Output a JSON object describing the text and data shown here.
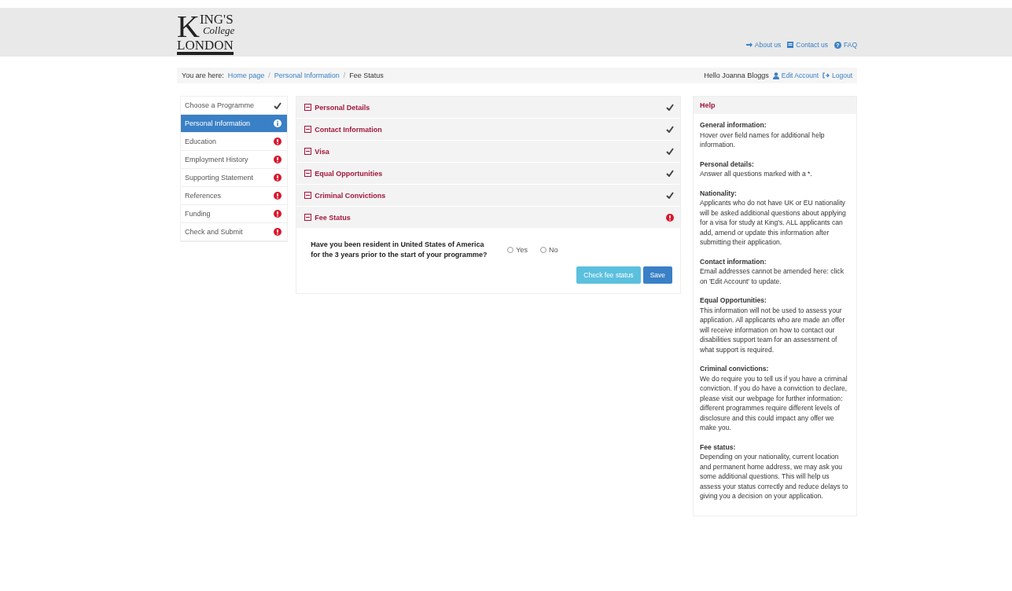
{
  "header": {
    "logo": {
      "initial": "K",
      "line1": "ING'S",
      "line2": "College",
      "line3": "LONDON"
    },
    "links": [
      {
        "kind": "about",
        "label": "About us"
      },
      {
        "kind": "contact",
        "label": "Contact us"
      },
      {
        "kind": "faq",
        "label": "FAQ",
        "icon": "?"
      }
    ]
  },
  "breadcrumb": {
    "prefix": "You are here:",
    "separator": "/",
    "items": [
      {
        "label": "Home page",
        "current": false
      },
      {
        "label": "Personal Information",
        "current": false
      },
      {
        "label": "Fee Status",
        "current": true
      }
    ]
  },
  "account": {
    "greeting": "Hello Joanna Bloggs",
    "edit": "Edit Account",
    "logout": "Logout"
  },
  "sidebar": {
    "items": [
      {
        "label": "Choose a Programme",
        "selected": false,
        "kind": "done"
      },
      {
        "label": "Personal Information",
        "selected": true,
        "kind": "current"
      },
      {
        "label": "Education",
        "selected": false,
        "kind": "error"
      },
      {
        "label": "Employment History",
        "selected": false,
        "kind": "error"
      },
      {
        "label": "Supporting Statement",
        "selected": false,
        "kind": "error"
      },
      {
        "label": "References",
        "selected": false,
        "kind": "error"
      },
      {
        "label": "Funding",
        "selected": false,
        "kind": "error"
      },
      {
        "label": "Check and Submit",
        "selected": false,
        "kind": "error"
      }
    ]
  },
  "sections": [
    {
      "title": "Personal Details",
      "kind": "done"
    },
    {
      "title": "Contact Information",
      "kind": "done"
    },
    {
      "title": "Visa",
      "kind": "done"
    },
    {
      "title": "Equal Opportunities",
      "kind": "done"
    },
    {
      "title": "Criminal Convictions",
      "kind": "done"
    },
    {
      "title": "Fee Status",
      "kind": "error"
    }
  ],
  "fee_status": {
    "question": "Have you been resident in United States of America for the 3 years prior to the start of your programme?",
    "options": [
      {
        "label": "Yes",
        "selected": false
      },
      {
        "label": "No",
        "selected": false
      }
    ],
    "buttons": [
      {
        "kind": "info",
        "label": "Check fee status"
      },
      {
        "kind": "primary",
        "label": "Save"
      }
    ]
  },
  "help": {
    "title": "Help",
    "sections": [
      {
        "heading": "General information:",
        "text": "Hover over field names for additional help information."
      },
      {
        "heading": "Personal details:",
        "text": "Answer all questions marked with a *."
      },
      {
        "heading": "Nationality:",
        "text": "Applicants who do not have UK or EU nationality will be asked additional questions about applying for a visa for study at King's. ALL applicants can add, amend or update this information after submitting their application."
      },
      {
        "heading": "Contact information:",
        "text": "Email addresses cannot be amended here: click on 'Edit Account' to update."
      },
      {
        "heading": "Equal Opportunities:",
        "text": "This information will not be used to assess your application. All applicants who are made an offer will receive information on how to contact our disabilities support team for an assessment of what support is required."
      },
      {
        "heading": "Criminal convictions:",
        "text": "We do require you to tell us if you have a criminal conviction. If you do have a conviction to declare, please visit our webpage for further information: different programmes require different levels of disclosure and this could impact any offer we make you."
      },
      {
        "heading": "Fee status:",
        "text": "Depending on your nationality, current location and permanent home address, we may ask you some additional questions. This will help us assess your status correctly and reduce delays to giving you a decision on your application."
      }
    ]
  }
}
